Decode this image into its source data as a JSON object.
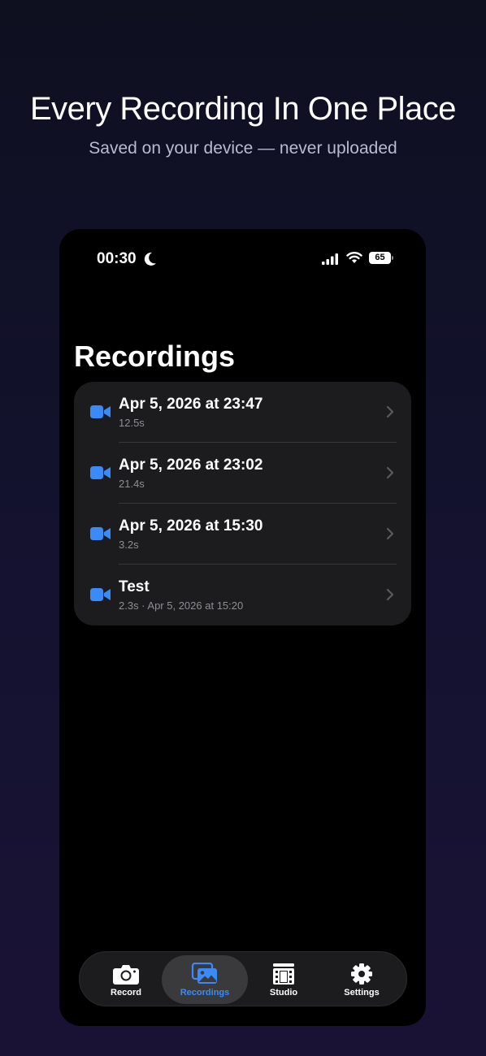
{
  "promo": {
    "title": "Every Recording In One Place",
    "subtitle": "Saved on your device — never uploaded"
  },
  "status_bar": {
    "time": "00:30",
    "battery_level": "65"
  },
  "page": {
    "title": "Recordings"
  },
  "recordings": [
    {
      "title": "Apr 5, 2026 at 23:47",
      "subtitle": "12.5s"
    },
    {
      "title": "Apr 5, 2026 at 23:02",
      "subtitle": "21.4s"
    },
    {
      "title": "Apr 5, 2026 at 15:30",
      "subtitle": "3.2s"
    },
    {
      "title": "Test",
      "subtitle": "2.3s · Apr 5, 2026 at 15:20"
    }
  ],
  "tab_bar": {
    "tabs": [
      {
        "label": "Record",
        "icon": "camera-icon",
        "selected": false
      },
      {
        "label": "Recordings",
        "icon": "photo-stack-icon",
        "selected": true
      },
      {
        "label": "Studio",
        "icon": "film-icon",
        "selected": false
      },
      {
        "label": "Settings",
        "icon": "gear-icon",
        "selected": false
      }
    ]
  },
  "colors": {
    "accent": "#3a8bf7",
    "card": "#1c1c1e",
    "secondary_text": "#8e8e93"
  }
}
